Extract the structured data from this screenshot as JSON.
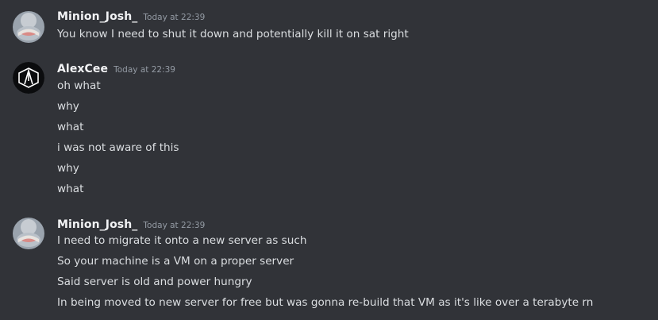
{
  "messages": [
    {
      "username": "Minion_Josh_",
      "timestamp": "Today at 22:39",
      "avatar_icon": "minion-avatar-icon",
      "lines": [
        "You know I need to shut it down and potentially kill it on sat right"
      ]
    },
    {
      "username": "AlexCee",
      "timestamp": "Today at 22:39",
      "avatar_icon": "linkin-park-avatar-icon",
      "lines": [
        "oh what",
        "why",
        "what",
        "i was not aware of this",
        "why",
        "what"
      ]
    },
    {
      "username": "Minion_Josh_",
      "timestamp": "Today at 22:39",
      "avatar_icon": "minion-avatar-icon",
      "lines": [
        "I need to migrate it onto a new server as such",
        "So your machine is a VM on a proper server",
        "Said server is old and power hungry",
        "In being moved to new server for free but was gonna re-build that VM as it's like over a terabyte rn"
      ]
    }
  ],
  "colors": {
    "background": "#313338",
    "username": "#f2f3f5",
    "timestamp": "#949ba4",
    "text": "#dbdee1"
  }
}
